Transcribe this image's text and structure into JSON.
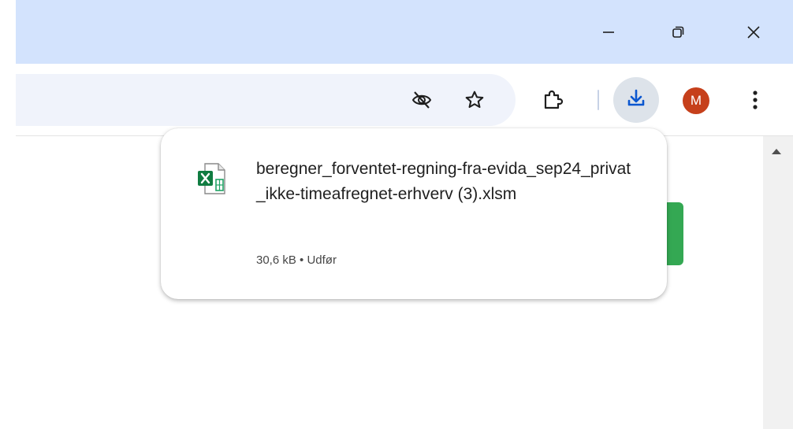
{
  "window": {
    "minimize_icon": "minimize-icon",
    "restore_icon": "restore-icon",
    "close_icon": "close-icon"
  },
  "toolbar": {
    "tracking_icon": "eye-off-icon",
    "bookmark_icon": "star-icon",
    "extensions_icon": "puzzle-icon",
    "downloads_icon": "download-icon",
    "profile_initial": "M",
    "menu_icon": "kebab-menu-icon"
  },
  "download_bubble": {
    "file_name": "beregner_forventet-regning-fra-evida_sep24_privat_ikke-timeafregnet-erhverv (3).xlsm",
    "file_meta": "30,6 kB • Udfør",
    "file_icon": "excel-file-icon"
  },
  "colors": {
    "titlebar": "#d3e3fd",
    "accent": "#0b57d0",
    "avatar": "#c6401b",
    "page_button": "#34a853"
  }
}
